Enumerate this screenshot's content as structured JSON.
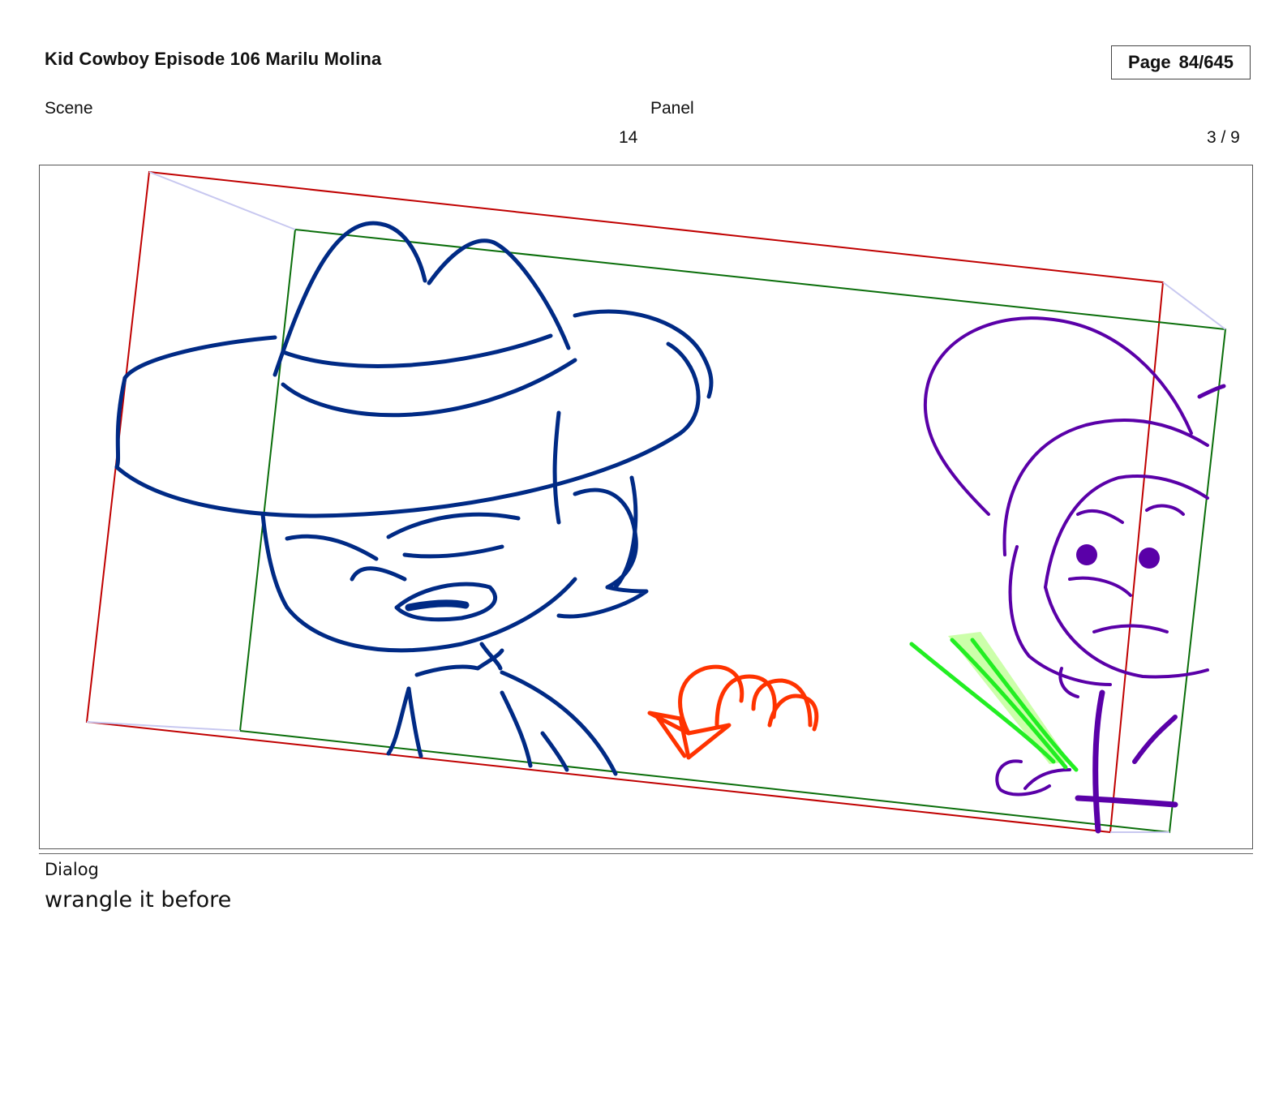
{
  "header": {
    "title": "Kid Cowboy Episode 106 Marilu Molina",
    "page_label": "Page",
    "page_value": "84/645"
  },
  "fields": {
    "scene_label": "Scene",
    "panel_label": "Panel",
    "scene_value": "14",
    "panel_value": "3 / 9"
  },
  "panel_image": {
    "content": "storyboard-sketch",
    "colors": {
      "kid_cowboy_lines": "#002a85",
      "second_character_lines": "#5a00a8",
      "motion_arrow": "#ff3300",
      "camera_frame_outer": "#c00000",
      "camera_frame_inner": "#0a6e0a",
      "motion_lines": "#22ee22"
    }
  },
  "dialog": {
    "label": "Dialog",
    "text": "wrangle it before"
  }
}
